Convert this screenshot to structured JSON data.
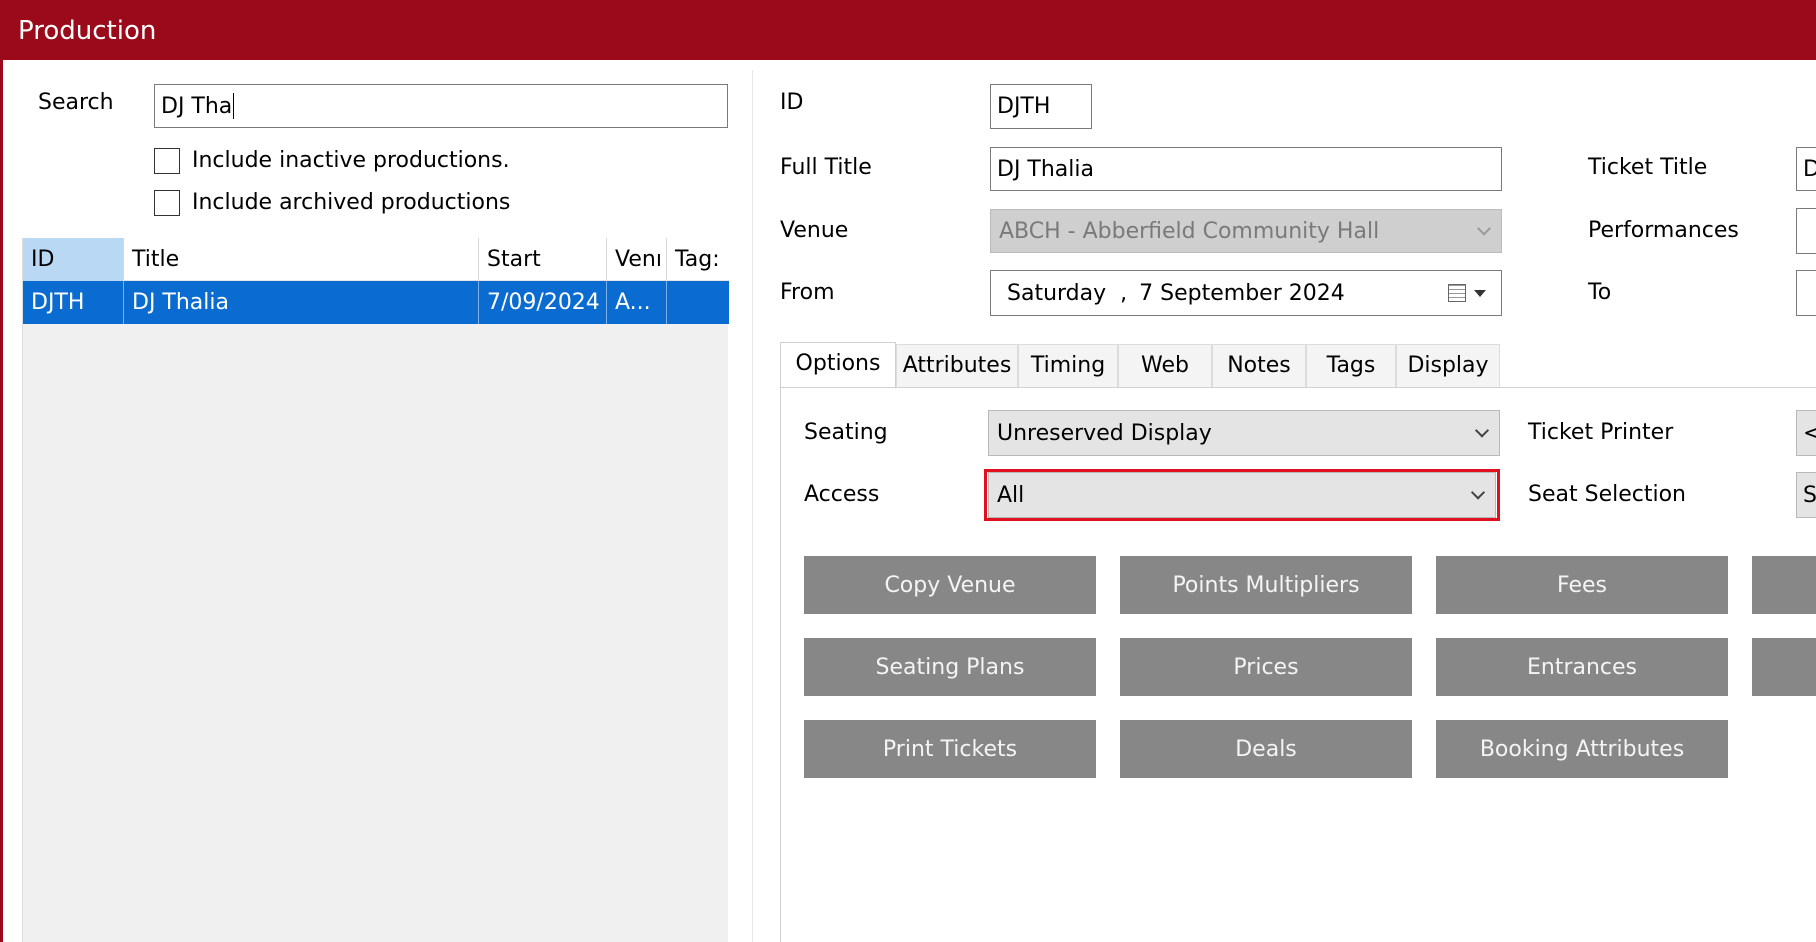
{
  "window": {
    "title": "Production"
  },
  "search": {
    "label": "Search",
    "value": "DJ Tha",
    "include_inactive": {
      "label": "Include inactive productions.",
      "checked": false
    },
    "include_archived": {
      "label": "Include archived productions",
      "checked": false
    }
  },
  "grid": {
    "columns": [
      "ID",
      "Title",
      "Start",
      "Venı",
      "Tag:"
    ],
    "rows": [
      {
        "id": "DJTH",
        "title": "DJ Thalia",
        "start": "7/09/2024",
        "venue": "A...",
        "tags": ""
      }
    ]
  },
  "detail": {
    "id_label": "ID",
    "id_value": "DJTH",
    "full_title_label": "Full Title",
    "full_title_value": "DJ Thalia",
    "ticket_title_label": "Ticket Title",
    "ticket_title_value": "D",
    "venue_label": "Venue",
    "venue_value": "ABCH - Abberfield Community Hall",
    "performances_label": "Performances",
    "from_label": "From",
    "from_day": "Saturday",
    "from_sep": ",",
    "from_date": "7 September 2024",
    "to_label": "To"
  },
  "tabs": [
    "Options",
    "Attributes",
    "Timing",
    "Web",
    "Notes",
    "Tags",
    "Display"
  ],
  "options": {
    "seating_label": "Seating",
    "seating_value": "Unreserved Display",
    "access_label": "Access",
    "access_value": "All",
    "ticket_printer_label": "Ticket Printer",
    "ticket_printer_value": "<",
    "seat_selection_label": "Seat Selection",
    "seat_selection_value": "S"
  },
  "buttons": {
    "copy_venue": "Copy Venue",
    "points_multipliers": "Points Multipliers",
    "fees": "Fees",
    "seating_plans": "Seating Plans",
    "prices": "Prices",
    "entrances": "Entrances",
    "print_tickets": "Print Tickets",
    "deals": "Deals",
    "booking_attributes": "Booking Attributes"
  },
  "colors": {
    "titlebar": "#9a0a1b",
    "selection": "#0a6bd1",
    "highlight": "#e0101e",
    "button": "#878787"
  }
}
